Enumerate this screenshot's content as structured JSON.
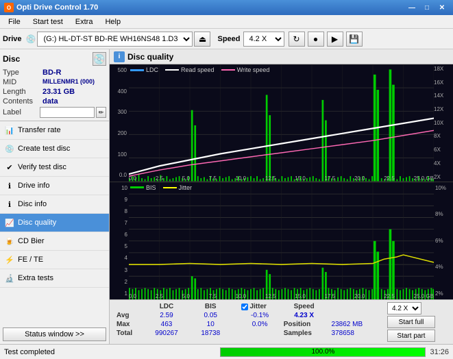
{
  "titleBar": {
    "title": "Opti Drive Control 1.70",
    "minimize": "—",
    "maximize": "□",
    "close": "✕"
  },
  "menuBar": {
    "items": [
      "File",
      "Start test",
      "Extra",
      "Help"
    ]
  },
  "toolbar": {
    "driveLabel": "Drive",
    "driveValue": "(G:) HL-DT-ST BD-RE  WH16NS48 1.D3",
    "speedLabel": "Speed",
    "speedValue": "4.2 X"
  },
  "disc": {
    "title": "Disc",
    "typeLabel": "Type",
    "typeValue": "BD-R",
    "midLabel": "MID",
    "midValue": "MILLENMR1 (000)",
    "lengthLabel": "Length",
    "lengthValue": "23.31 GB",
    "contentsLabel": "Contents",
    "contentsValue": "data",
    "labelLabel": "Label"
  },
  "navItems": [
    {
      "id": "transfer-rate",
      "label": "Transfer rate"
    },
    {
      "id": "create-test-disc",
      "label": "Create test disc"
    },
    {
      "id": "verify-test-disc",
      "label": "Verify test disc"
    },
    {
      "id": "drive-info",
      "label": "Drive info"
    },
    {
      "id": "disc-info",
      "label": "Disc info"
    },
    {
      "id": "disc-quality",
      "label": "Disc quality",
      "active": true
    },
    {
      "id": "cd-bier",
      "label": "CD Bier"
    },
    {
      "id": "fe-te",
      "label": "FE / TE"
    },
    {
      "id": "extra-tests",
      "label": "Extra tests"
    }
  ],
  "statusWindowBtn": "Status window >>",
  "discQuality": {
    "title": "Disc quality",
    "legend": {
      "ldc": "LDC",
      "readSpeed": "Read speed",
      "writeSpeed": "Write speed"
    },
    "legendLower": {
      "bis": "BIS",
      "jitter": "Jitter"
    },
    "upperYLeft": [
      "500",
      "400",
      "300",
      "200",
      "100",
      "0.0"
    ],
    "upperYRight": [
      "18X",
      "16X",
      "14X",
      "12X",
      "10X",
      "8X",
      "6X",
      "4X",
      "2X"
    ],
    "lowerYLeft": [
      "10",
      "9",
      "8",
      "7",
      "6",
      "5",
      "4",
      "3",
      "2",
      "1"
    ],
    "lowerYRight": [
      "10%",
      "8%",
      "6%",
      "4%",
      "2%"
    ],
    "xLabels": [
      "0.0",
      "2.5",
      "5.0",
      "7.5",
      "10.0",
      "12.5",
      "15.0",
      "17.5",
      "20.0",
      "22.5",
      "25.0 GB"
    ]
  },
  "stats": {
    "headers": [
      "",
      "LDC",
      "BIS",
      "",
      "Jitter",
      "Speed",
      ""
    ],
    "rows": [
      {
        "label": "Avg",
        "ldc": "2.59",
        "bis": "0.05",
        "jitter": "-0.1%",
        "speedLabel": "Position",
        "speedValue": "23862 MB"
      },
      {
        "label": "Max",
        "ldc": "463",
        "bis": "10",
        "jitter": "0.0%",
        "positionLabel": "Position",
        "positionValue": "23862 MB"
      },
      {
        "label": "Total",
        "ldc": "990267",
        "bis": "18738",
        "jitter": "",
        "samplesLabel": "Samples",
        "samplesValue": "378658"
      }
    ],
    "speedDisplay": "4.23 X",
    "speedCombo": "4.2 X",
    "startFull": "Start full",
    "startPart": "Start part",
    "jitterLabel": "✓ Jitter",
    "speedValueLabel": "4.23 X"
  },
  "statusBar": {
    "text": "Test completed",
    "progress": 100,
    "progressText": "100.0%",
    "time": "31:26"
  }
}
